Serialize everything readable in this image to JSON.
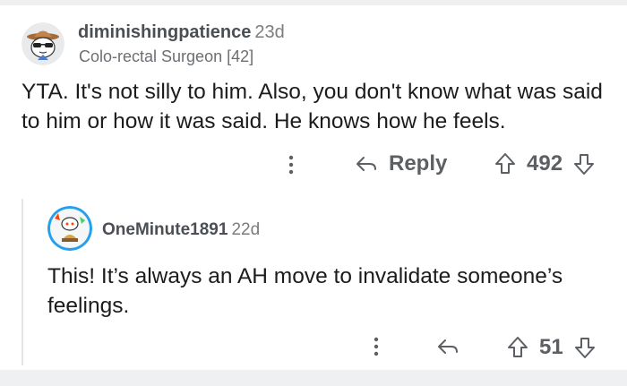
{
  "comments": [
    {
      "username": "diminishingpatience",
      "age": "23d",
      "flair": "Colo-rectal Surgeon [42]",
      "body": "YTA. It's not silly to him. Also, you don't know what was said to him or how it was said. He knows how he feels.",
      "reply_label": "Reply",
      "score": "492"
    },
    {
      "username": "OneMinute1891",
      "age": "22d",
      "body": "This! It’s always an AH move to invalidate someone’s feelings.",
      "score": "51"
    }
  ],
  "icons": {
    "more": "more-vertical-icon",
    "reply": "reply-arrow-icon",
    "upvote": "upvote-arrow-icon",
    "downvote": "downvote-arrow-icon"
  },
  "colors": {
    "text": "#1c1c1c",
    "meta": "#7c7c7c",
    "action": "#5c6064",
    "background_strip": "#eef0f2"
  }
}
